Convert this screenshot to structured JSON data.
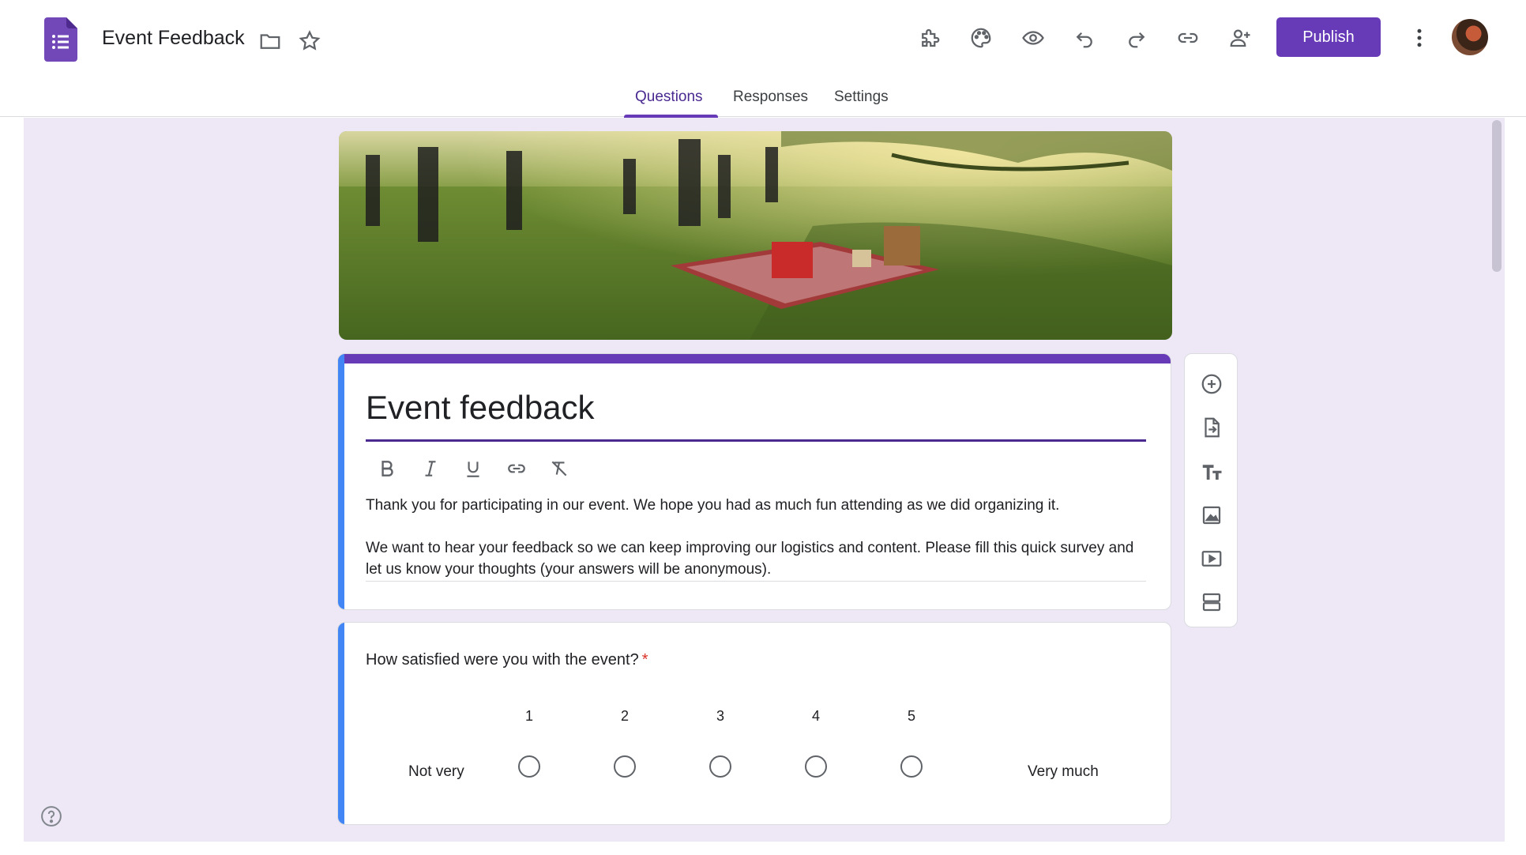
{
  "header": {
    "doc_title": "Event Feedback",
    "publish_label": "Publish"
  },
  "tabs": [
    {
      "label": "Questions",
      "active": true
    },
    {
      "label": "Responses",
      "active": false
    },
    {
      "label": "Settings",
      "active": false
    }
  ],
  "colors": {
    "accent": "#673ab7",
    "canvas_bg": "#ede7f6",
    "card_left_bar": "#4285f4",
    "required": "#d93025"
  },
  "icons": {
    "header": [
      "forms-logo-icon",
      "folder-icon",
      "star-icon",
      "addon-puzzle-icon",
      "palette-icon",
      "preview-eye-icon",
      "undo-icon",
      "redo-icon",
      "link-icon",
      "add-collaborator-icon",
      "more-vert-icon"
    ],
    "format": [
      "bold-icon",
      "italic-icon",
      "underline-icon",
      "insert-link-icon",
      "clear-format-icon"
    ],
    "side": [
      "add-question-icon",
      "import-questions-icon",
      "add-title-icon",
      "add-image-icon",
      "add-video-icon",
      "add-section-icon"
    ],
    "footer": [
      "help-icon"
    ]
  },
  "form": {
    "title": "Event feedback",
    "description": [
      "Thank you for participating in our event. We hope you had as much fun attending as we did organizing it.",
      "We want to hear your feedback so we can keep improving our logistics and content. Please fill this quick survey and let us know your thoughts (your answers will be anonymous)."
    ]
  },
  "question": {
    "text": "How satisfied were you with the event?",
    "required_mark": "*",
    "scale": [
      "1",
      "2",
      "3",
      "4",
      "5"
    ],
    "low_label": "Not very",
    "high_label": "Very much"
  }
}
